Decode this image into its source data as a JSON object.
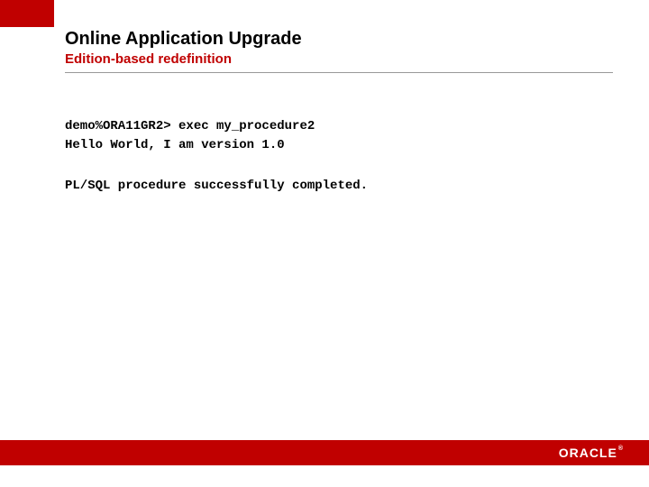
{
  "header": {
    "title": "Online Application Upgrade",
    "subtitle": "Edition-based redefinition"
  },
  "terminal": {
    "line1": "demo%ORA11GR2> exec my_procedure2",
    "line2": "Hello World, I am version 1.0",
    "line3": "PL/SQL procedure successfully completed."
  },
  "footer": {
    "brand": "ORACLE",
    "trademark": "®"
  }
}
